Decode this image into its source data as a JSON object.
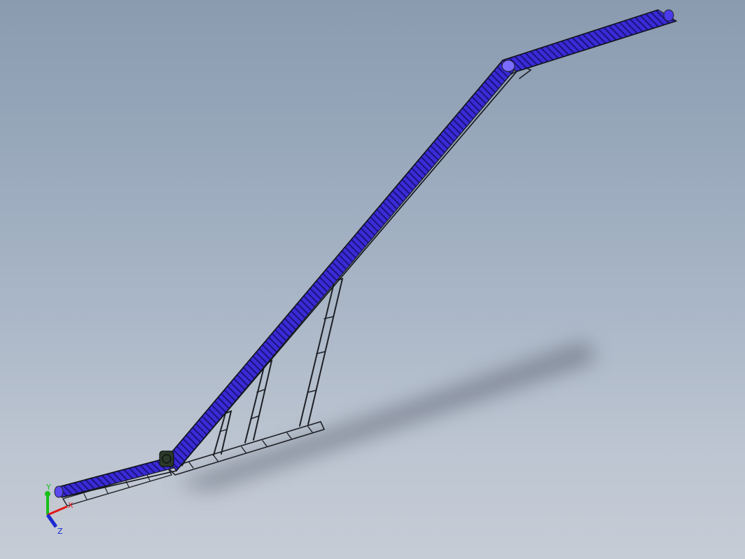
{
  "viewport": {
    "background_top": "#8a9bb0",
    "background_bottom": "#c6ccd6"
  },
  "model": {
    "belt_color": "#3a2bd6",
    "belt_highlight": "#7a6cff",
    "frame_color": "#1e2026",
    "shadow_color": "#5d6472"
  },
  "triad": {
    "x_label": "X",
    "y_label": "Y",
    "z_label": "Z",
    "x_color": "#e01818",
    "y_color": "#18c018",
    "z_color": "#1a2ad0"
  }
}
